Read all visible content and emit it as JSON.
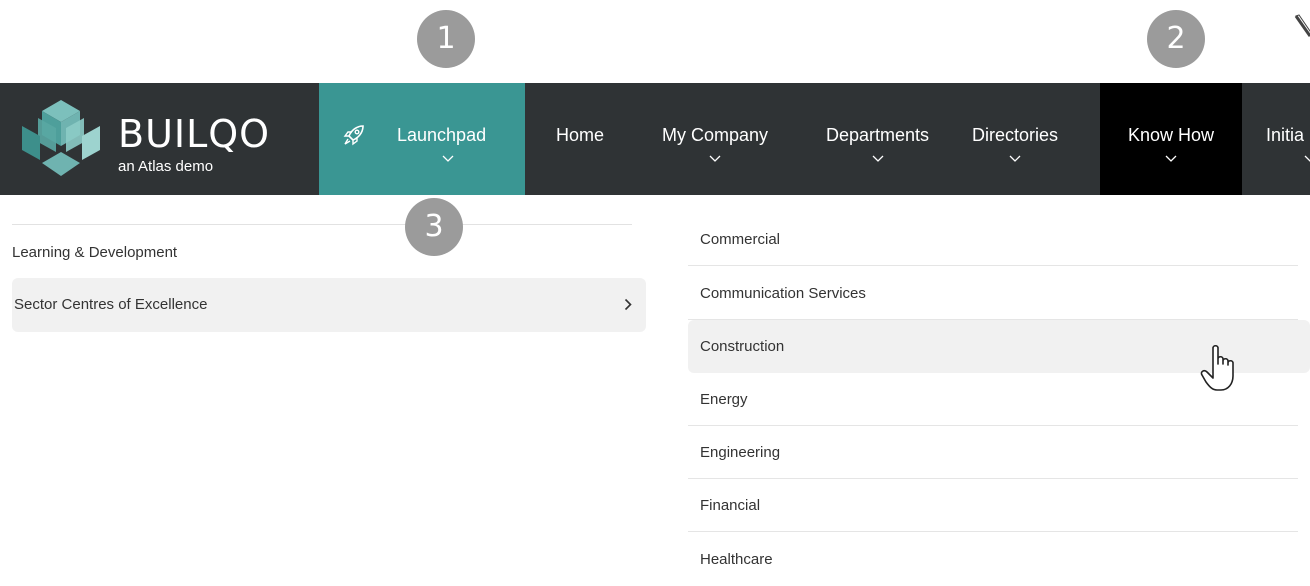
{
  "badges": [
    "1",
    "2",
    "3"
  ],
  "logo": {
    "name": "BUILQO",
    "tagline": "an Atlas demo"
  },
  "nav": {
    "launchpad": "Launchpad",
    "home": "Home",
    "my_company": "My Company",
    "departments": "Departments",
    "directories": "Directories",
    "know_how": "Know How",
    "initia": "Initia"
  },
  "left_menu": {
    "items": [
      {
        "label": "Learning & Development"
      },
      {
        "label": "Sector Centres of Excellence"
      }
    ]
  },
  "sub_menu": {
    "items": [
      {
        "label": "Commercial"
      },
      {
        "label": "Communication Services"
      },
      {
        "label": "Construction"
      },
      {
        "label": "Energy"
      },
      {
        "label": "Engineering"
      },
      {
        "label": "Financial"
      },
      {
        "label": "Healthcare"
      }
    ]
  },
  "colors": {
    "navbar": "#2f3335",
    "launchpad_active": "#3a9693",
    "know_how_active": "#000000",
    "badge": "#9b9b9b",
    "logo_teal": "#6fb3b0"
  }
}
